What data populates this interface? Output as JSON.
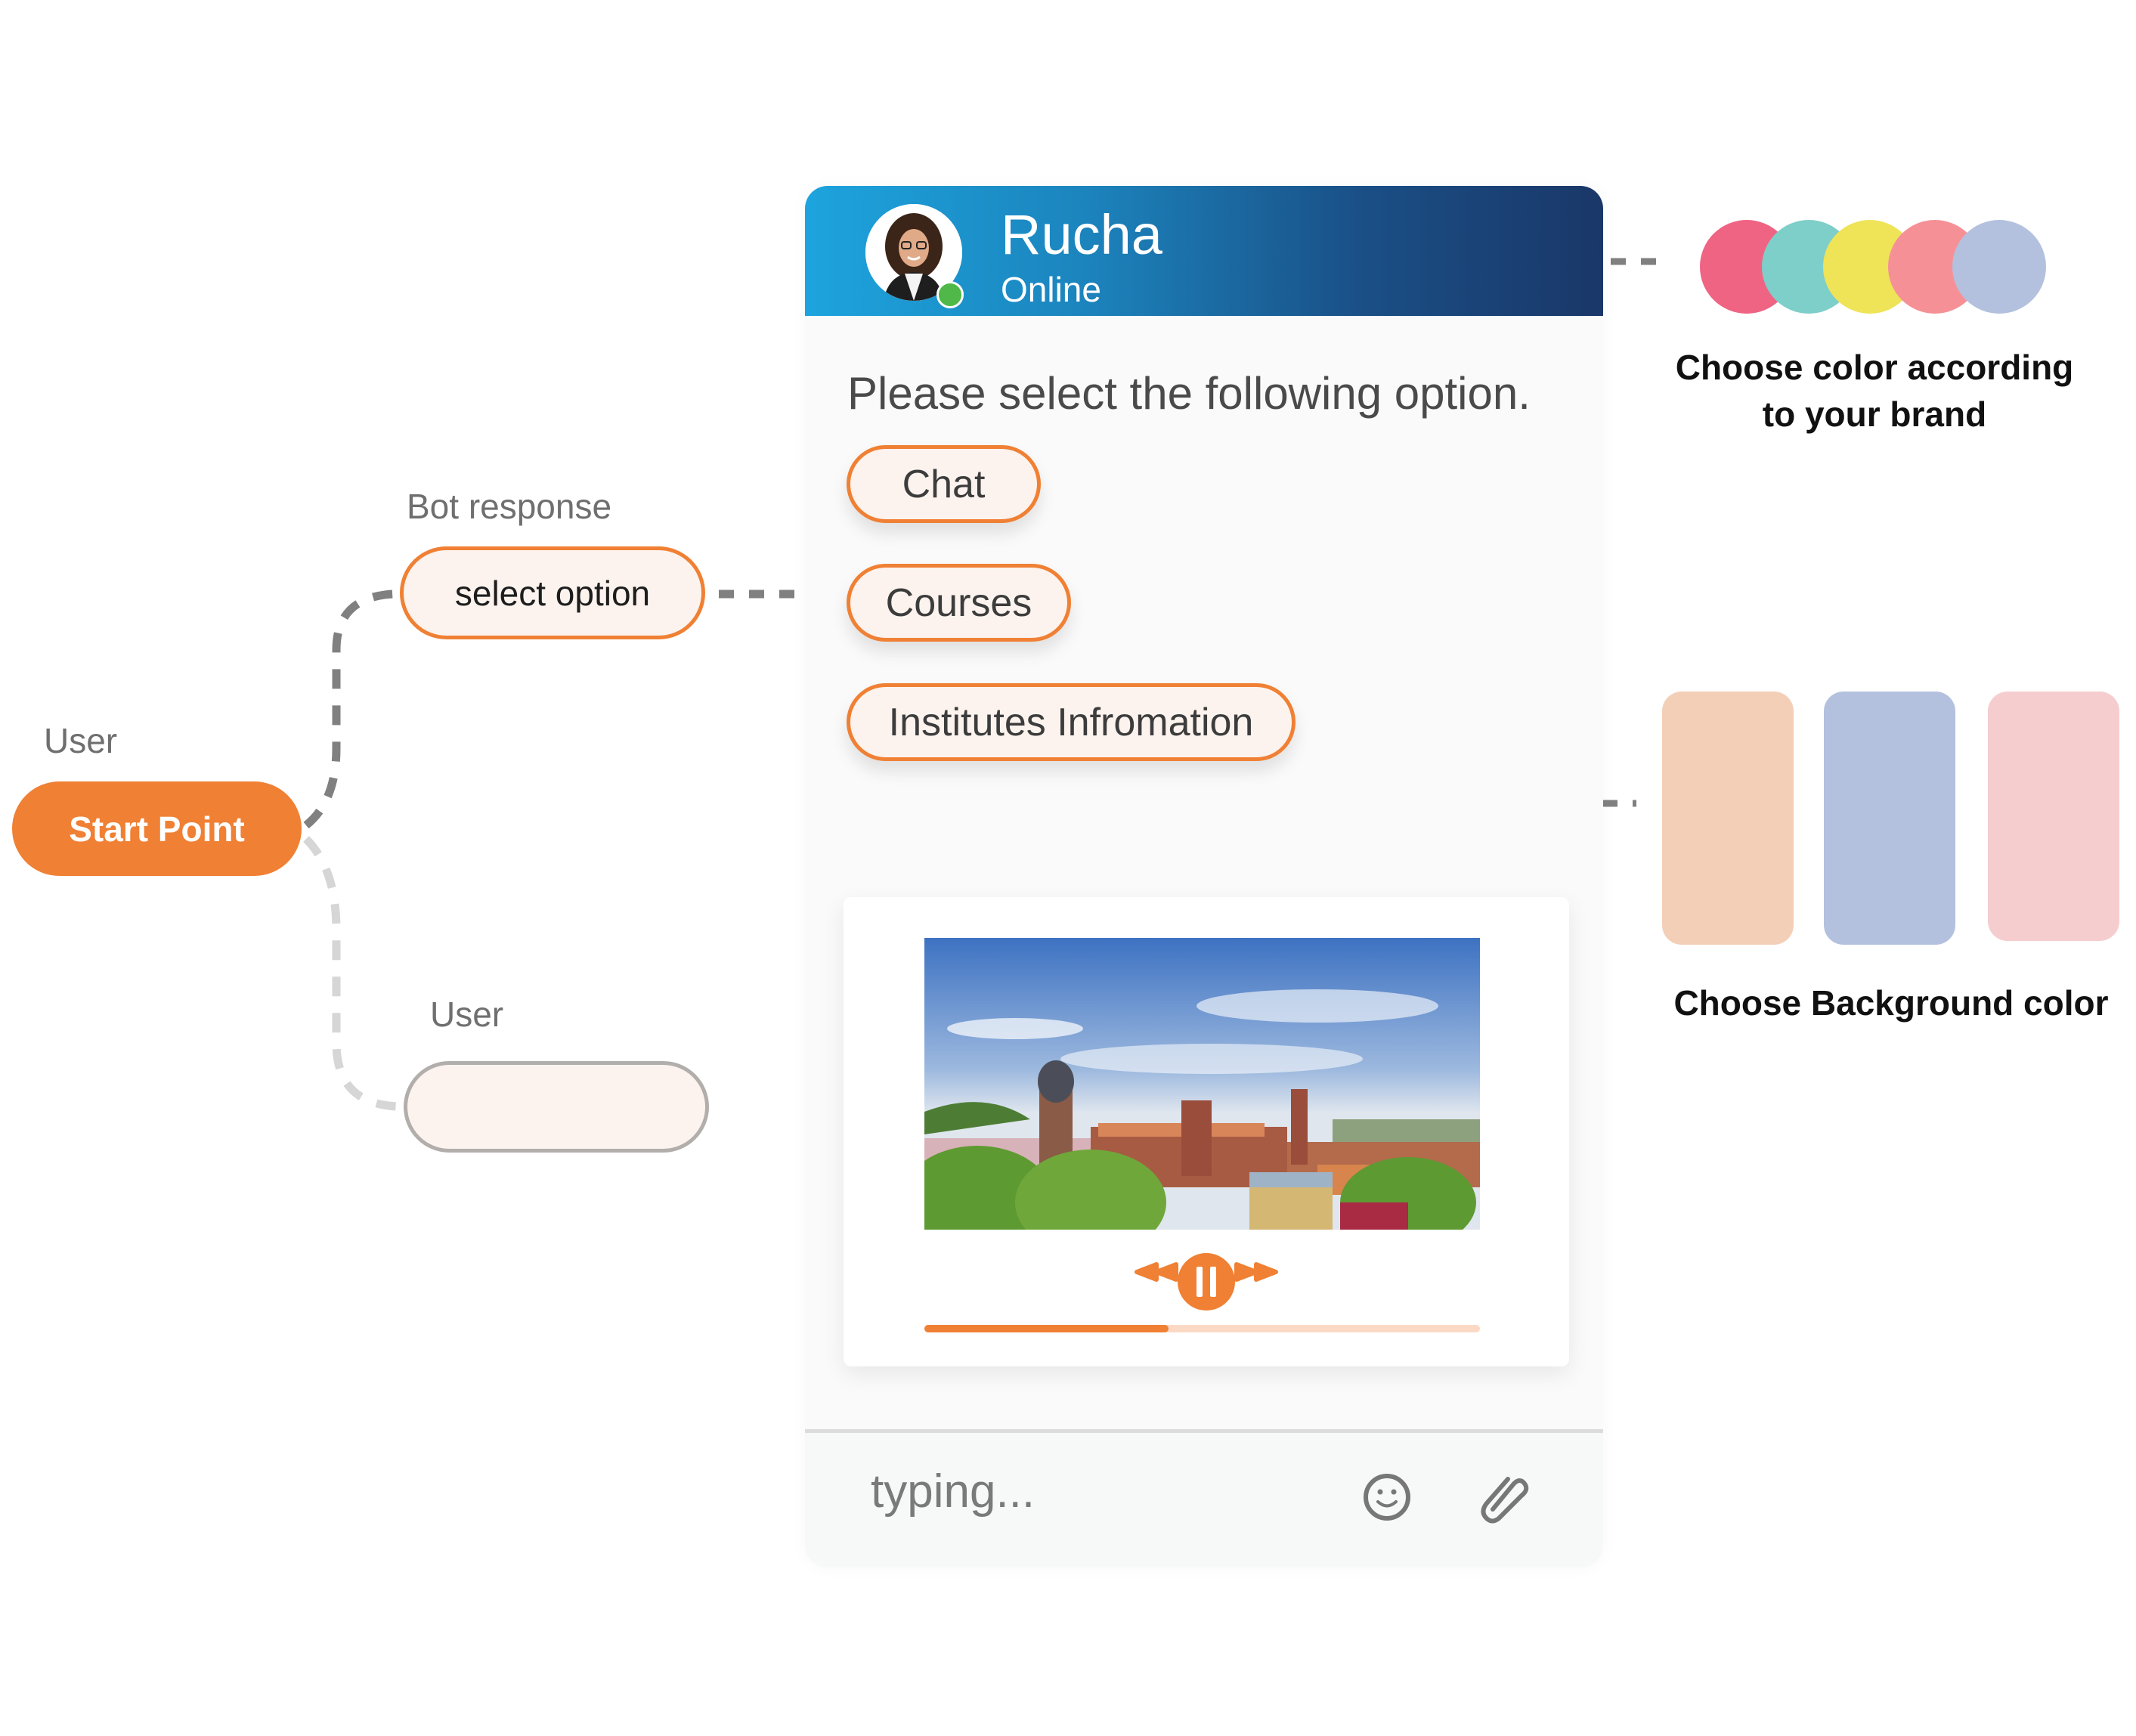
{
  "flow": {
    "start_label": "User",
    "start_node": "Start Point",
    "bot_label": "Bot response",
    "bot_node": "select option",
    "user_label": "User",
    "user_node": ""
  },
  "chat": {
    "agent_name": "Rucha",
    "agent_status": "Online",
    "prompt": "Please select the following option.",
    "options": [
      {
        "label": "Chat"
      },
      {
        "label": "Courses"
      },
      {
        "label": "Institutes Infromation"
      }
    ],
    "video": {
      "image_alt": "Aerial view of university campus",
      "progress": 0.44,
      "controls": [
        "rewind-icon",
        "pause-icon",
        "fast-forward-icon"
      ]
    },
    "composer": {
      "placeholder": "typing...",
      "icons": [
        "emoji-icon",
        "paperclip-icon"
      ]
    }
  },
  "brand_colors": {
    "caption_line1": "Choose color according",
    "caption_line2": "to your brand",
    "colors": [
      "#ef6383",
      "#7ecec9",
      "#efe358",
      "#f59196",
      "#b3c1de"
    ]
  },
  "background_colors": {
    "caption": "Choose Background color",
    "colors": [
      "#f3cfb8",
      "#b3c1de",
      "#f6cdcf"
    ]
  },
  "theme": {
    "accent": "#f08034",
    "header_gradient_start": "#1da4de",
    "header_gradient_end": "#1a3768",
    "online": "#4fb848"
  }
}
